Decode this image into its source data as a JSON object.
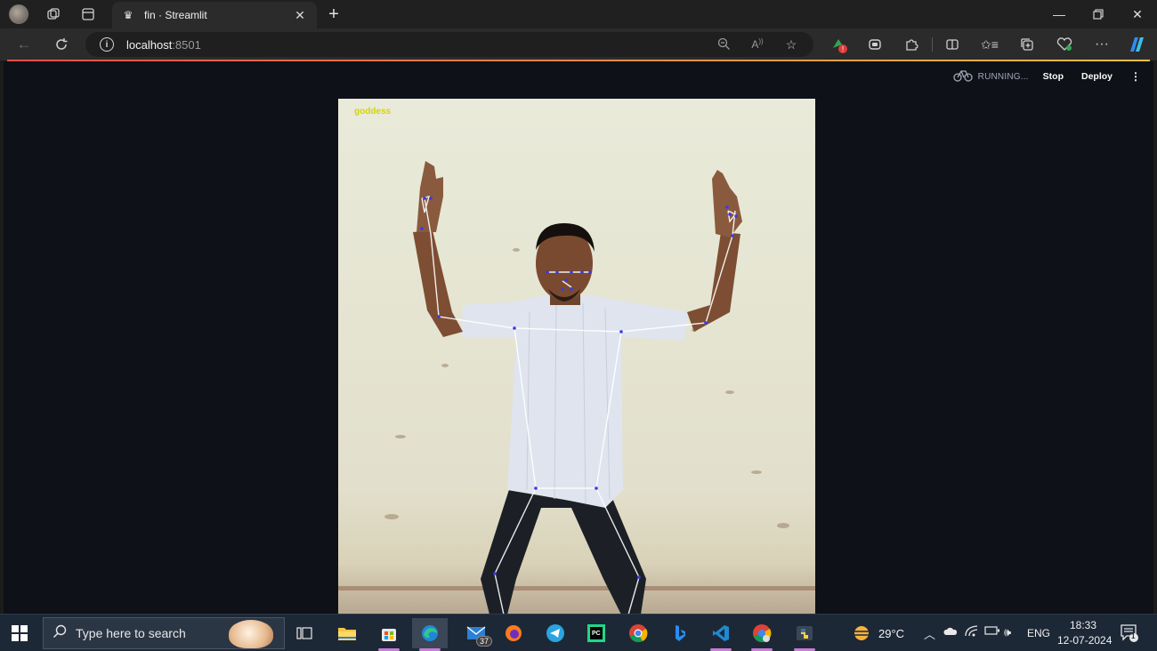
{
  "browser": {
    "tab": {
      "title": "fin · Streamlit",
      "favicon": "streamlit-crown-icon"
    },
    "address": {
      "host": "localhost",
      "port": ":8501"
    }
  },
  "streamlit": {
    "status": "RUNNING...",
    "stop_label": "Stop",
    "deploy_label": "Deploy",
    "menu_label": "⋮"
  },
  "image": {
    "pose_label": "goddess",
    "label_color": "#d6d600",
    "wall_color": "#e8e8d6"
  },
  "taskbar": {
    "search_placeholder": "Type here to search",
    "mail_badge": "37",
    "weather": "29°C",
    "language": "ENG",
    "time": "18:33",
    "date": "12-07-2024",
    "notification_count": "1"
  },
  "colors": {
    "accent_start": "#ff4b4b",
    "accent_end": "#ffbd45",
    "app_bg": "#0e1117",
    "taskbar_bg": "#1d2836"
  }
}
